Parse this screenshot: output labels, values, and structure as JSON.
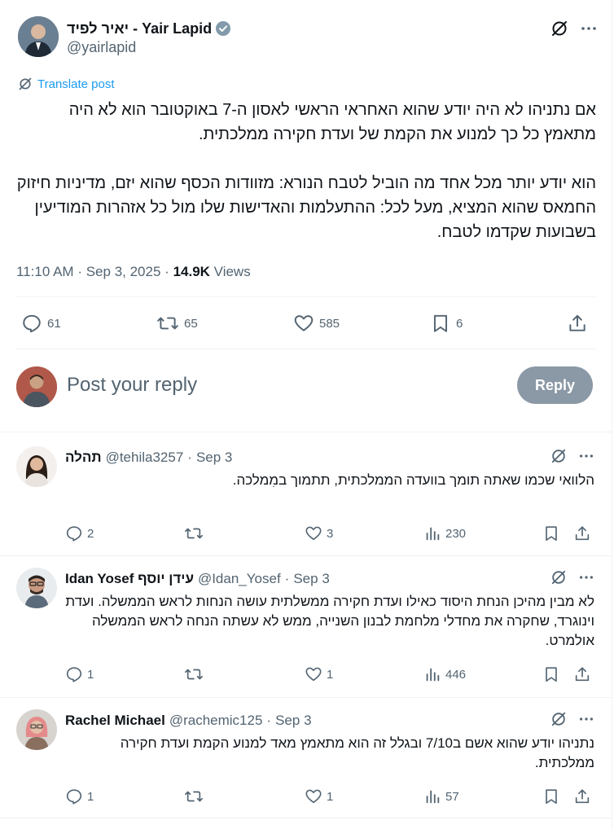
{
  "main": {
    "author_name": "יאיר לפיד - Yair Lapid",
    "handle": "@yairlapid",
    "translate_label": "Translate post",
    "text": "אם נתניהו לא היה יודע שהוא האחראי הראשי לאסון ה-7 באוקטובר הוא לא היה מתאמץ כל כך למנוע את הקמת של ועדת חקירה ממלכתית.\n\nהוא יודע יותר מכל אחד מה הוביל לטבח הנורא: מזוודות הכסף שהוא יזם, מדיניות חיזוק החמאס שהוא המציא, מעל לכל: ההתעלמות והאדישות שלו מול כל אזהרות המודיעין בשבועות שקדמו לטבח.",
    "time": "11:10 AM",
    "date": "Sep 3, 2025",
    "views": "14.9K",
    "views_label": "Views",
    "stats": {
      "replies": "61",
      "reposts": "65",
      "likes": "585",
      "bookmarks": "6"
    }
  },
  "compose": {
    "placeholder": "Post your reply",
    "button": "Reply"
  },
  "replies": [
    {
      "name": "תהלה",
      "handle": "@tehila3257",
      "date": "Sep 3",
      "text": "הלוואי שכמו שאתה תומך בוועדה הממלכתית, תתמוך במִמלכה.",
      "replies": "2",
      "reposts": "",
      "likes": "3",
      "views": "230"
    },
    {
      "name": "Idan Yosef עידן יוסף",
      "handle": "@Idan_Yosef",
      "date": "Sep 3",
      "text": "לא מבין מהיכן הנחת היסוד כאילו ועדת חקירה ממשלתית עושה הנחות לראש הממשלה. ועדת וינוגרד, שחקרה את מחדלי מלחמת לבנון השנייה, ממש לא עשתה הנחה לראש הממשלה אולמרט.",
      "replies": "1",
      "reposts": "",
      "likes": "1",
      "views": "446"
    },
    {
      "name": "Rachel Michael",
      "handle": "@rachemic125",
      "date": "Sep 3",
      "text": "נתניהו יודע שהוא אשם ב7/10 ובגלל זה הוא מתאמץ מאד למנוע הקמת ועדת חקירה ממלכתית.",
      "replies": "1",
      "reposts": "",
      "likes": "1",
      "views": "57"
    }
  ],
  "separator": "·",
  "colors": {
    "accent": "#1d9bf0",
    "verified": "#829aab",
    "muted": "#536471",
    "reply_button": "#8b98a5"
  },
  "icons": [
    "grok-icon",
    "more-icon",
    "verified-badge-icon",
    "translate-icon",
    "reply-icon",
    "repost-icon",
    "like-icon",
    "bookmark-icon",
    "share-icon",
    "views-icon"
  ]
}
